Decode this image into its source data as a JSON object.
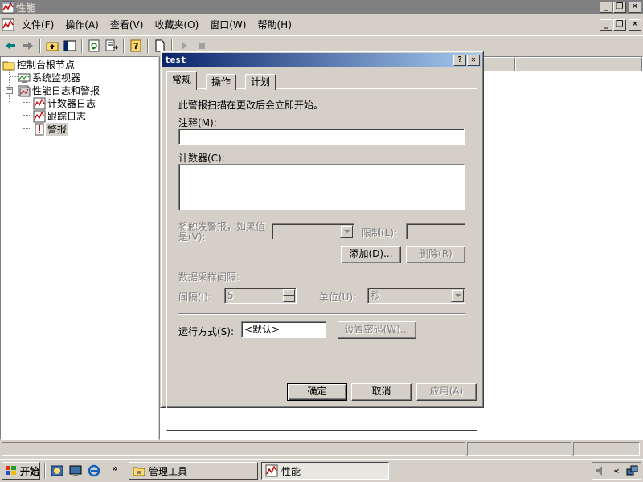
{
  "app": {
    "title": "性能",
    "menu": [
      "文件(F)",
      "操作(A)",
      "查看(V)",
      "收藏夹(O)",
      "窗口(W)",
      "帮助(H)"
    ]
  },
  "tree": {
    "items": [
      {
        "label": "控制台根节点",
        "icon": "folder-icon"
      },
      {
        "label": "系统监视器",
        "icon": "system-monitor-icon"
      },
      {
        "label": "性能日志和警报",
        "icon": "perf-logs-icon"
      },
      {
        "label": "计数器日志",
        "icon": "counter-log-icon"
      },
      {
        "label": "跟踪日志",
        "icon": "trace-log-icon"
      },
      {
        "label": "警报",
        "icon": "alert-icon"
      }
    ]
  },
  "dialog": {
    "title": "test",
    "tabs": [
      "常规",
      "操作",
      "计划"
    ],
    "intro": "此警报扫描在更改后会立即开始。",
    "comment_label": "注释(M):",
    "comment_value": "",
    "counters_label": "计数器(C):",
    "trigger_label": "将触发警报，如果值是(V):",
    "limit_label": "限制(L):",
    "add_button": "添加(D)...",
    "remove_button": "删除(R)",
    "sample_interval_label": "数据采样间隔:",
    "interval_label": "间隔(I):",
    "interval_value": "5",
    "unit_label": "单位(U):",
    "unit_value": "秒",
    "run_as_label": "运行方式(S):",
    "run_as_value": "<默认>",
    "set_password_button": "设置密码(W)...",
    "ok_button": "确定",
    "cancel_button": "取消",
    "apply_button": "应用(A)"
  },
  "taskbar": {
    "start_label": "开始",
    "tasks": [
      "管理工具",
      "性能"
    ],
    "overflow": "»",
    "tray_chevron": "«"
  }
}
